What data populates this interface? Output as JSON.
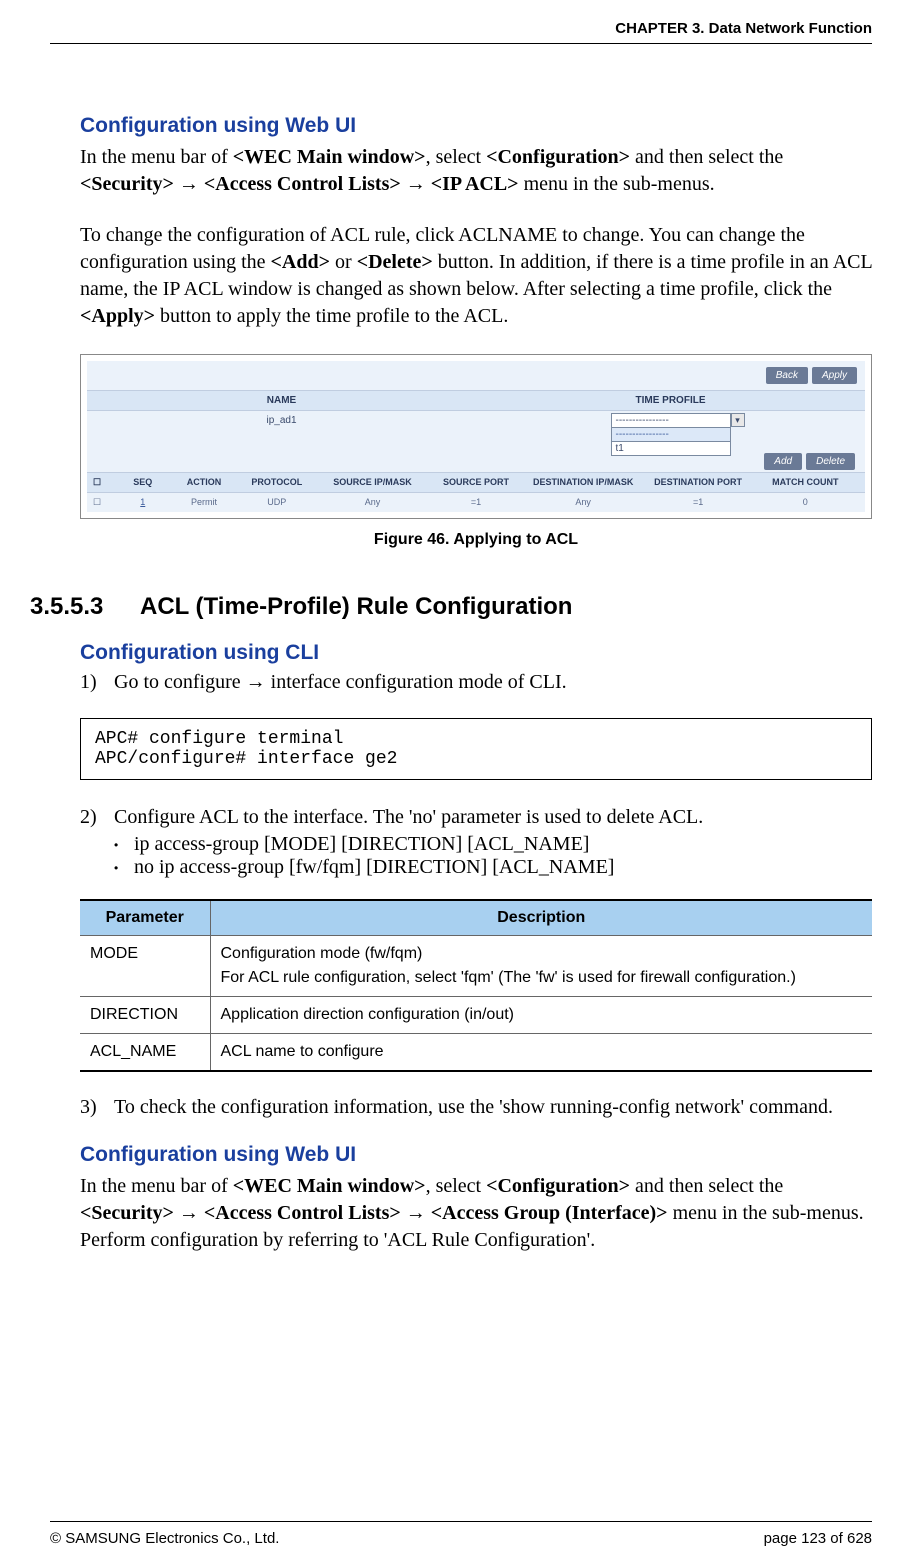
{
  "header": {
    "chapter": "CHAPTER 3. Data Network Function"
  },
  "section1": {
    "title": "Configuration using Web UI",
    "para1_parts": {
      "p1": "In the menu bar of ",
      "b1": "<WEC Main window>",
      "p2": ", select ",
      "b2": "<Configuration>",
      "p3": " and then select the ",
      "b3": "<Security>",
      "p4": " ",
      "arrow1": "→",
      "p5": " ",
      "b4": "<Access Control Lists>",
      "p6": " ",
      "arrow2": "→",
      "p7": " ",
      "b5": "<IP ACL>",
      "p8": " menu in the sub-menus."
    },
    "para2_parts": {
      "p1": "To change the configuration of ACL rule, click ACLNAME to change. You can change the configuration using the ",
      "b1": "<Add>",
      "p2": " or ",
      "b2": "<Delete>",
      "p3": " button. In addition, if there is a time profile in an ACL name, the IP ACL window is changed as shown below. After selecting a time profile, click the ",
      "b3": "<Apply>",
      "p4": " button to apply the time profile to the ACL."
    }
  },
  "figure": {
    "btn_back": "Back",
    "btn_apply": "Apply",
    "hdr_name": "NAME",
    "hdr_profile": "TIME PROFILE",
    "name_val": "ip_ad1",
    "dd_blank": "----------------",
    "dd_t1": "t1",
    "btn_add": "Add",
    "btn_delete": "Delete",
    "cols": {
      "seq": "SEQ",
      "action": "ACTION",
      "proto": "PROTOCOL",
      "sip": "SOURCE IP/MASK",
      "sport": "SOURCE PORT",
      "dip": "DESTINATION IP/MASK",
      "dport": "DESTINATION PORT",
      "match": "MATCH COUNT"
    },
    "row": {
      "seq": "1",
      "action": "Permit",
      "proto": "UDP",
      "sip": "Any",
      "sport": "=1",
      "dip": "Any",
      "dport": "=1",
      "match": "0"
    },
    "caption": "Figure 46. Applying to ACL"
  },
  "section2": {
    "number": "3.5.5.3",
    "title": "ACL (Time-Profile) Rule Configuration",
    "cli_title": "Configuration using CLI",
    "step1_num": "1)",
    "step1_text": "Go to configure → interface configuration mode of CLI.",
    "code": "APC# configure terminal\nAPC/configure# interface ge2",
    "step2_num": "2)",
    "step2_text": "Configure ACL to the interface. The 'no' parameter is used to delete ACL.",
    "bullet1": "ip access-group [MODE] [DIRECTION] [ACL_NAME]",
    "bullet2": "no ip access-group [fw/fqm] [DIRECTION] [ACL_NAME]",
    "table": {
      "h1": "Parameter",
      "h2": "Description",
      "r1c1": "MODE",
      "r1c2": "Configuration mode (fw/fqm)\nFor ACL rule configuration, select 'fqm' (The 'fw' is used for firewall configuration.)",
      "r2c1": "DIRECTION",
      "r2c2": "Application direction configuration (in/out)",
      "r3c1": "ACL_NAME",
      "r3c2": "ACL name to configure"
    },
    "step3_num": "3)",
    "step3_text": "To check the configuration information, use the 'show running-config network' command.",
    "webui_title": "Configuration using Web UI",
    "webui_para_parts": {
      "p1": "In the menu bar of ",
      "b1": "<WEC Main window>",
      "p2": ", select ",
      "b2": "<Configuration>",
      "p3": " and then select the ",
      "b3": "<Security>",
      "p4": " ",
      "arrow1": "→",
      "p5": " ",
      "b4": "<Access Control Lists>",
      "p6": " ",
      "arrow2": "→",
      "p7": " ",
      "b5": "<Access Group (Interface)>",
      "p8": " menu in the sub-menus."
    },
    "webui_para2": "Perform configuration by referring to 'ACL Rule Configuration'."
  },
  "footer": {
    "copyright": "© SAMSUNG Electronics Co., Ltd.",
    "page": "page 123 of 628"
  }
}
